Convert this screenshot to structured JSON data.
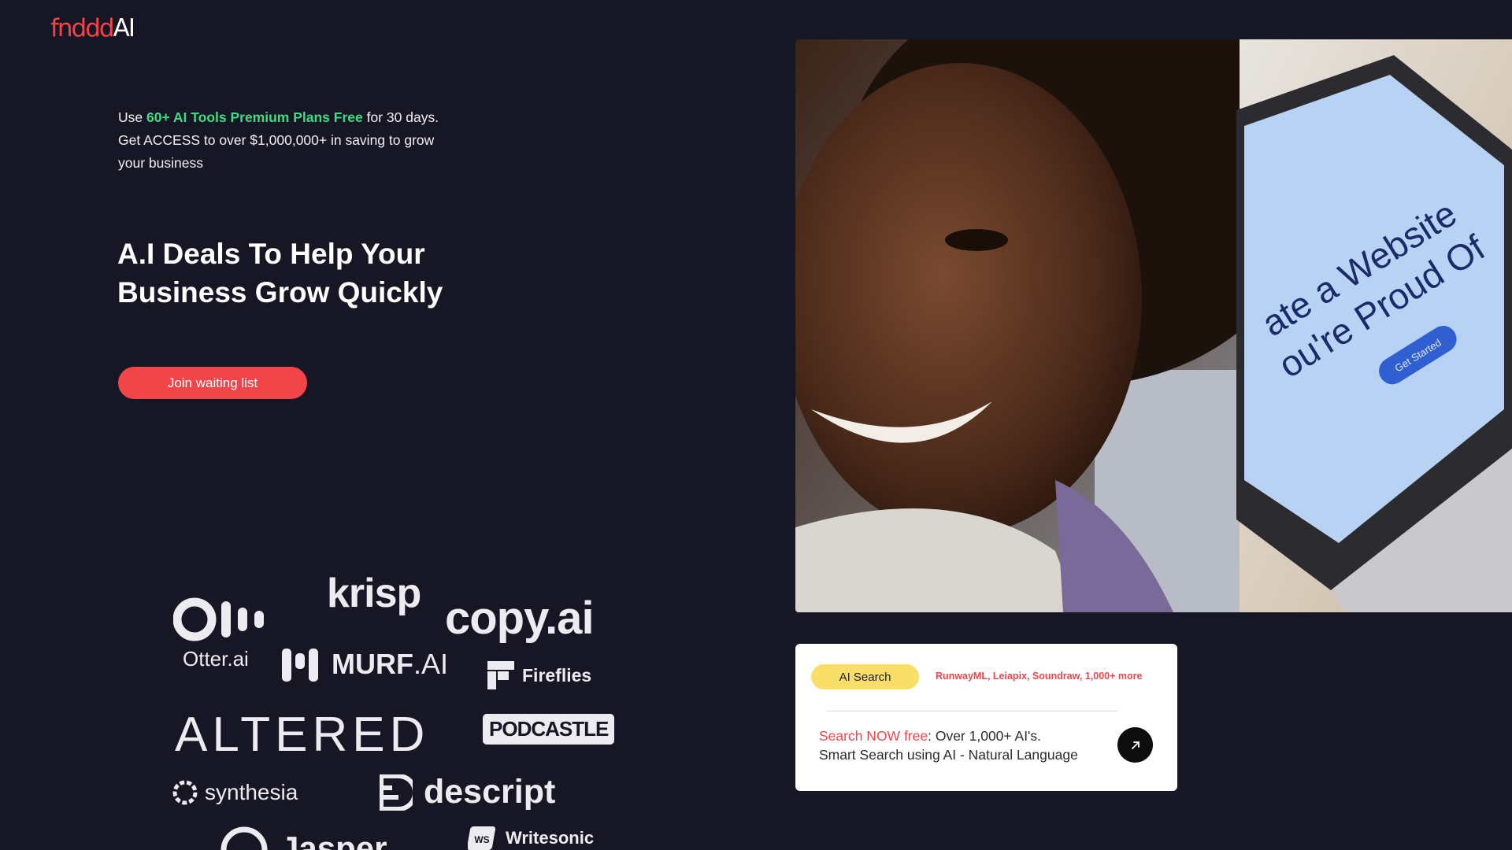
{
  "logo": {
    "part1": "fnddd",
    "part2": "AI"
  },
  "intro": {
    "prefix": "Use ",
    "highlight": "60+ AI Tools Premium Plans Free",
    "suffix": " for 30 days. Get ACCESS to over $1,000,000+ in saving to grow your business"
  },
  "headline": "A.I Deals To Help Your Business Grow Quickly",
  "cta_label": "Join waiting list",
  "brands": {
    "otter": "Otter.ai",
    "krisp": "krisp",
    "copyai": "copy.ai",
    "murf": "MURF",
    "murf_ai": ".AI",
    "fireflies": "Fireflies",
    "altered": "ALTERED",
    "podcastle": "PODCASTLE",
    "synthesia": "synthesia",
    "descript": "descript",
    "jasper": "Jasper",
    "writesonic": "Writesonic",
    "writesonic_mark": "WS"
  },
  "hero": {
    "laptop_title_1": "ate a Website",
    "laptop_title_2": "ou're Proud Of",
    "laptop_button": "Get Started"
  },
  "search": {
    "pill_label": "AI Search",
    "examples": "RunwayML, Leiapix, Soundraw, 1,000+ more",
    "prompt_red": "Search NOW free",
    "prompt_line1_rest": ": Over 1,000+ AI's.",
    "prompt_line2": "Smart Search using AI - Natural Language"
  },
  "colors": {
    "background": "#171624",
    "accent_red": "#f2454a",
    "accent_green": "#3ddc84",
    "pill_yellow": "#f9df6a"
  },
  "icons": {
    "go_button": "arrow-up-right-icon"
  }
}
